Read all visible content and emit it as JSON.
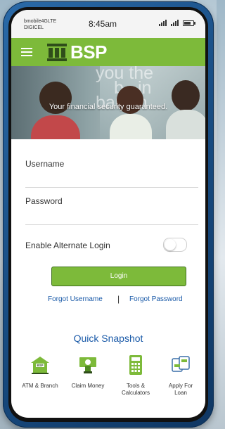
{
  "status_bar": {
    "carrier_line1": "bmobile4GLTE",
    "carrier_line2": "DIGICEL",
    "time": "8:45am"
  },
  "header": {
    "brand": "BSP",
    "icons": [
      "menu-icon"
    ]
  },
  "hero": {
    "watermark_line1": "you the",
    "watermark_line2": "b",
    "watermark_line3": "in",
    "watermark_line4": "bankin",
    "caption": "Your financial security guaranteed."
  },
  "form": {
    "username_label": "Username",
    "username_value": "",
    "password_label": "Password",
    "password_value": "",
    "alternate_login_label": "Enable Alternate Login",
    "alternate_login_enabled": false,
    "login_label": "Login",
    "forgot_username": "Forgot Username",
    "separator": "|",
    "forgot_password": "Forgot Password"
  },
  "quick_snapshot": {
    "title": "Quick Snapshot",
    "items": [
      {
        "label": "ATM & Branch",
        "icon": "atm-branch-icon",
        "badge": "BSP"
      },
      {
        "label": "Claim Money",
        "icon": "claim-money-icon"
      },
      {
        "label": "Tools &\nCalculators",
        "icon": "calculator-icon"
      },
      {
        "label": "Apply For\nLoan",
        "icon": "loan-icon"
      }
    ]
  },
  "colors": {
    "brand_green": "#7dba3a",
    "link_blue": "#1a5aa8",
    "phone_blue": "#1a4f86"
  }
}
